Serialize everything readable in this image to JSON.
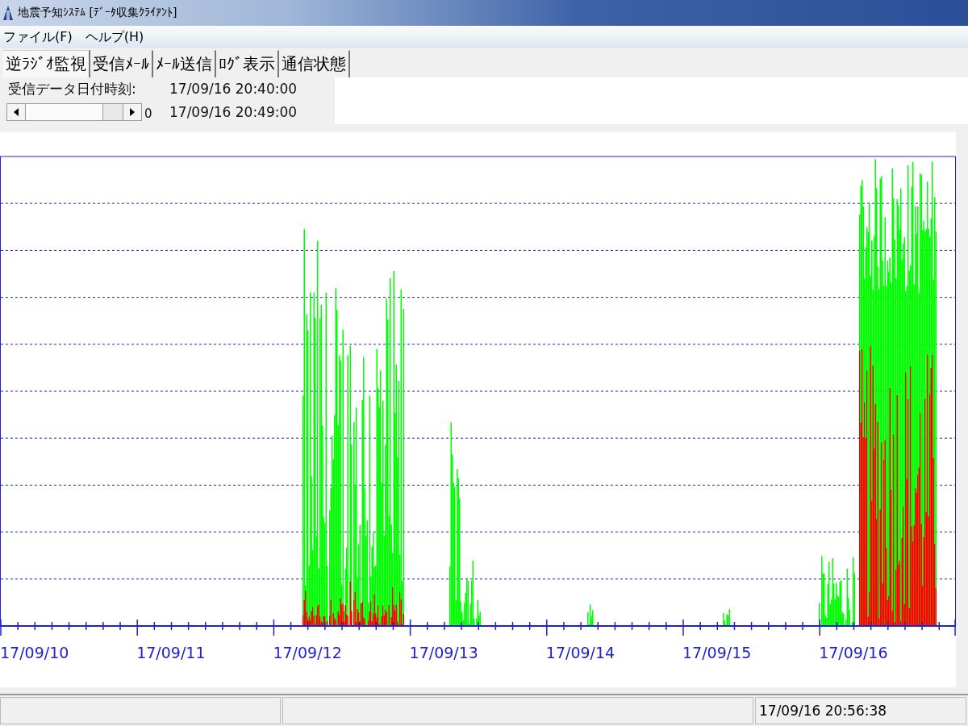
{
  "window": {
    "title": "地震予知ｼｽﾃﾑ [ﾃﾞｰﾀ収集ｸﾗｲｱﾝﾄ]"
  },
  "menu": [
    "ファイル(F)",
    "ヘルプ(H)"
  ],
  "tabs": [
    {
      "label": "逆ﾗｼﾞｵ監視",
      "selected": true
    },
    {
      "label": "受信ﾒｰﾙ",
      "selected": false
    },
    {
      "label": "ﾒｰﾙ送信",
      "selected": false
    },
    {
      "label": "ﾛｸﾞ表示",
      "selected": false
    },
    {
      "label": "通信状態",
      "selected": false
    }
  ],
  "info": {
    "label": "受信データ日付時刻:",
    "received_time": "17/09/16 20:40:00",
    "scroll_value": "0",
    "current_time": "17/09/16 20:49:00"
  },
  "chart": {
    "x_labels": [
      "17/09/10",
      "17/09/11",
      "17/09/12",
      "17/09/13",
      "17/09/14",
      "17/09/15",
      "17/09/16"
    ]
  },
  "status_bar": {
    "time": "17/09/16 20:56:38"
  }
}
